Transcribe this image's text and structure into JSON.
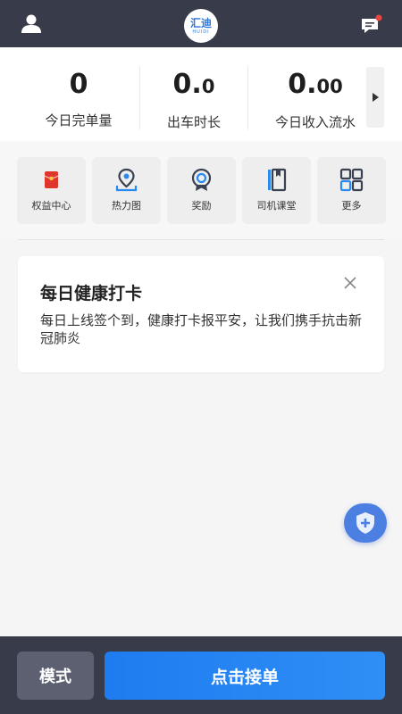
{
  "header": {
    "logo_text": "汇迪",
    "logo_sub": "HUIDI",
    "user_icon": "user-icon",
    "message_icon": "message-icon",
    "accent": "#2b76d8",
    "badge_color": "#e8473f"
  },
  "stats": {
    "orders": {
      "value": "0",
      "label": "今日完单量"
    },
    "hours": {
      "value_main": "0.",
      "value_small": "0",
      "label": "出车时长"
    },
    "income": {
      "value_main": "0.",
      "value_small": "00",
      "label": "今日收入流水"
    }
  },
  "tiles": [
    {
      "label": "权益中心",
      "icon": "red-envelope-icon"
    },
    {
      "label": "热力图",
      "icon": "map-pin-icon"
    },
    {
      "label": "奖励",
      "icon": "reward-icon"
    },
    {
      "label": "司机课堂",
      "icon": "book-icon"
    },
    {
      "label": "更多",
      "icon": "grid-icon"
    }
  ],
  "card": {
    "title": "每日健康打卡",
    "text": "每日上线签个到，健康打卡报平安，让我们携手抗击新冠肺炎"
  },
  "fab": {
    "icon": "shield-plus-icon"
  },
  "bottom": {
    "mode_label": "模式",
    "accept_label": "点击接单",
    "accept_color": "#1e7cf0"
  }
}
